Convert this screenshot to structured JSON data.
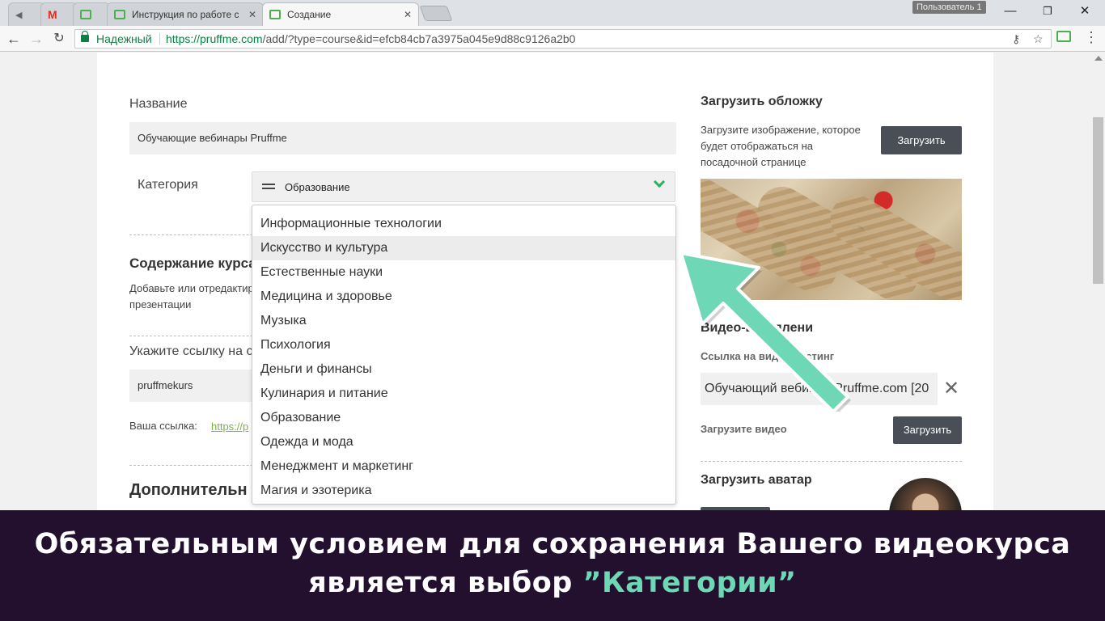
{
  "browser": {
    "tabs": [
      {
        "title": ""
      },
      {
        "title": ""
      },
      {
        "title": ""
      },
      {
        "title": "Инструкция по работе с"
      },
      {
        "title": "Создание"
      }
    ],
    "user_badge": "Пользователь 1",
    "secure_label": "Надежный",
    "url_host": "https://pruffme.com",
    "url_rest": "/add/?type=course&id=efcb84cb7a3975a045e9d88c9126a2b0"
  },
  "form": {
    "name_label": "Название",
    "name_value": "Обучающие вебинары Pruffme",
    "category_label": "Категория",
    "category_value": "Образование",
    "category_options": [
      "Информационные технологии",
      "Искусство и культура",
      "Естественные науки",
      "Медицина и здоровье",
      "Музыка",
      "Психология",
      "Деньги и финансы",
      "Кулинария и питание",
      "Образование",
      "Одежда и мода",
      "Менеджмент и маркетинг",
      "Магия и эзотерика"
    ],
    "hover_option_index": 1,
    "content_title": "Содержание курса",
    "content_note_1": "Добавьте или отредактир",
    "content_note_2": "презентации",
    "link_label": "Укажите ссылку на с",
    "link_value": "pruffmekurs",
    "your_link_label": "Ваша ссылка:",
    "your_link_value": "https://p",
    "extra_title": "Дополнительн"
  },
  "sidebar": {
    "cover_title": "Загрузить обложку",
    "cover_note": [
      "Загрузите изображение, которое",
      "будет отображаться на",
      "посадочной странице"
    ],
    "upload_label": "Загрузить",
    "video_title": "Видео-вступлени",
    "video_host_label": "Ссылка на видео-хостинг",
    "video_value": "Обучающий вебинар Pruffme.com [20",
    "upload_video_label": "Загрузите видео",
    "upload_video_btn": "Загрузить",
    "avatar_title": "Загрузить аватар"
  },
  "caption": {
    "line1": "Обязательным условием для сохранения Вашего видеокурса",
    "line2_prefix": "является выбор ",
    "line2_accent": "”Категории”"
  },
  "colors": {
    "accent_green": "#29b35a",
    "arrow": "#6ed7b5",
    "caption_bg": "#22102e",
    "button_dark": "#4a4f57"
  }
}
